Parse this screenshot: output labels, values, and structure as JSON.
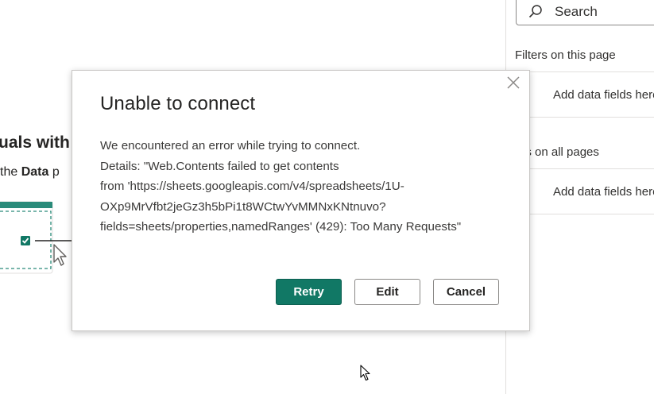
{
  "background": {
    "heading_fragment": "uals with",
    "sub_prefix": "the",
    "sub_bold": "Data",
    "sub_suffix": "p"
  },
  "filters_pane": {
    "search_placeholder": "Search",
    "section_1_title": "Filters on this page",
    "section_1_add": "Add data fields here",
    "section_2_title": "ers on all pages",
    "section_2_add": "Add data fields here"
  },
  "dialog": {
    "title": "Unable to connect",
    "body_lines": [
      "We encountered an error while trying to connect.",
      "Details: \"Web.Contents failed to get contents",
      "from 'https://sheets.googleapis.com/v4/spreadsheets/1U-",
      "OXp9MrVfbt2jeGz3h5bPi1t8WCtwYvMMNxKNtnuvo?",
      "fields=sheets/properties,namedRanges' (429): Too Many Requests\""
    ],
    "buttons": {
      "retry": "Retry",
      "edit": "Edit",
      "cancel": "Cancel"
    }
  },
  "colors": {
    "accent": "#117865",
    "pane_border": "#e1dfdd"
  },
  "icons": {
    "search": "search-icon",
    "close": "close-icon",
    "checkbox": "checkbox-checked-icon",
    "cursor": "mouse-pointer-icon"
  }
}
